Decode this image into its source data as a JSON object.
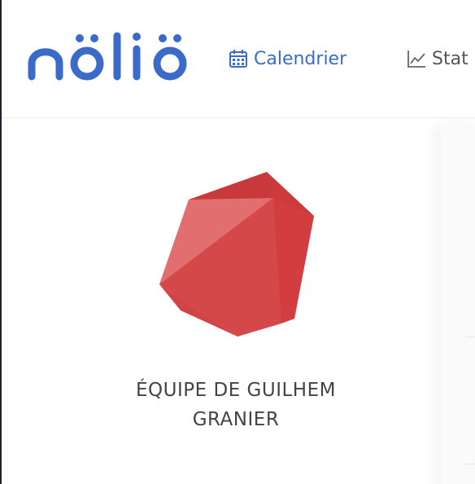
{
  "app": {
    "logo_text": "nölïö",
    "brand_color": "#3b6bc9"
  },
  "nav": {
    "items": [
      {
        "label": "Calendrier",
        "icon": "calendar-icon",
        "active": true
      },
      {
        "label": "Stat",
        "icon": "line-chart-icon",
        "active": false
      }
    ]
  },
  "team": {
    "name": "ÉQUIPE DE GUILHEM GRANIER",
    "emblem_icon": "red-gem-icon",
    "emblem_color": "#d94446"
  }
}
